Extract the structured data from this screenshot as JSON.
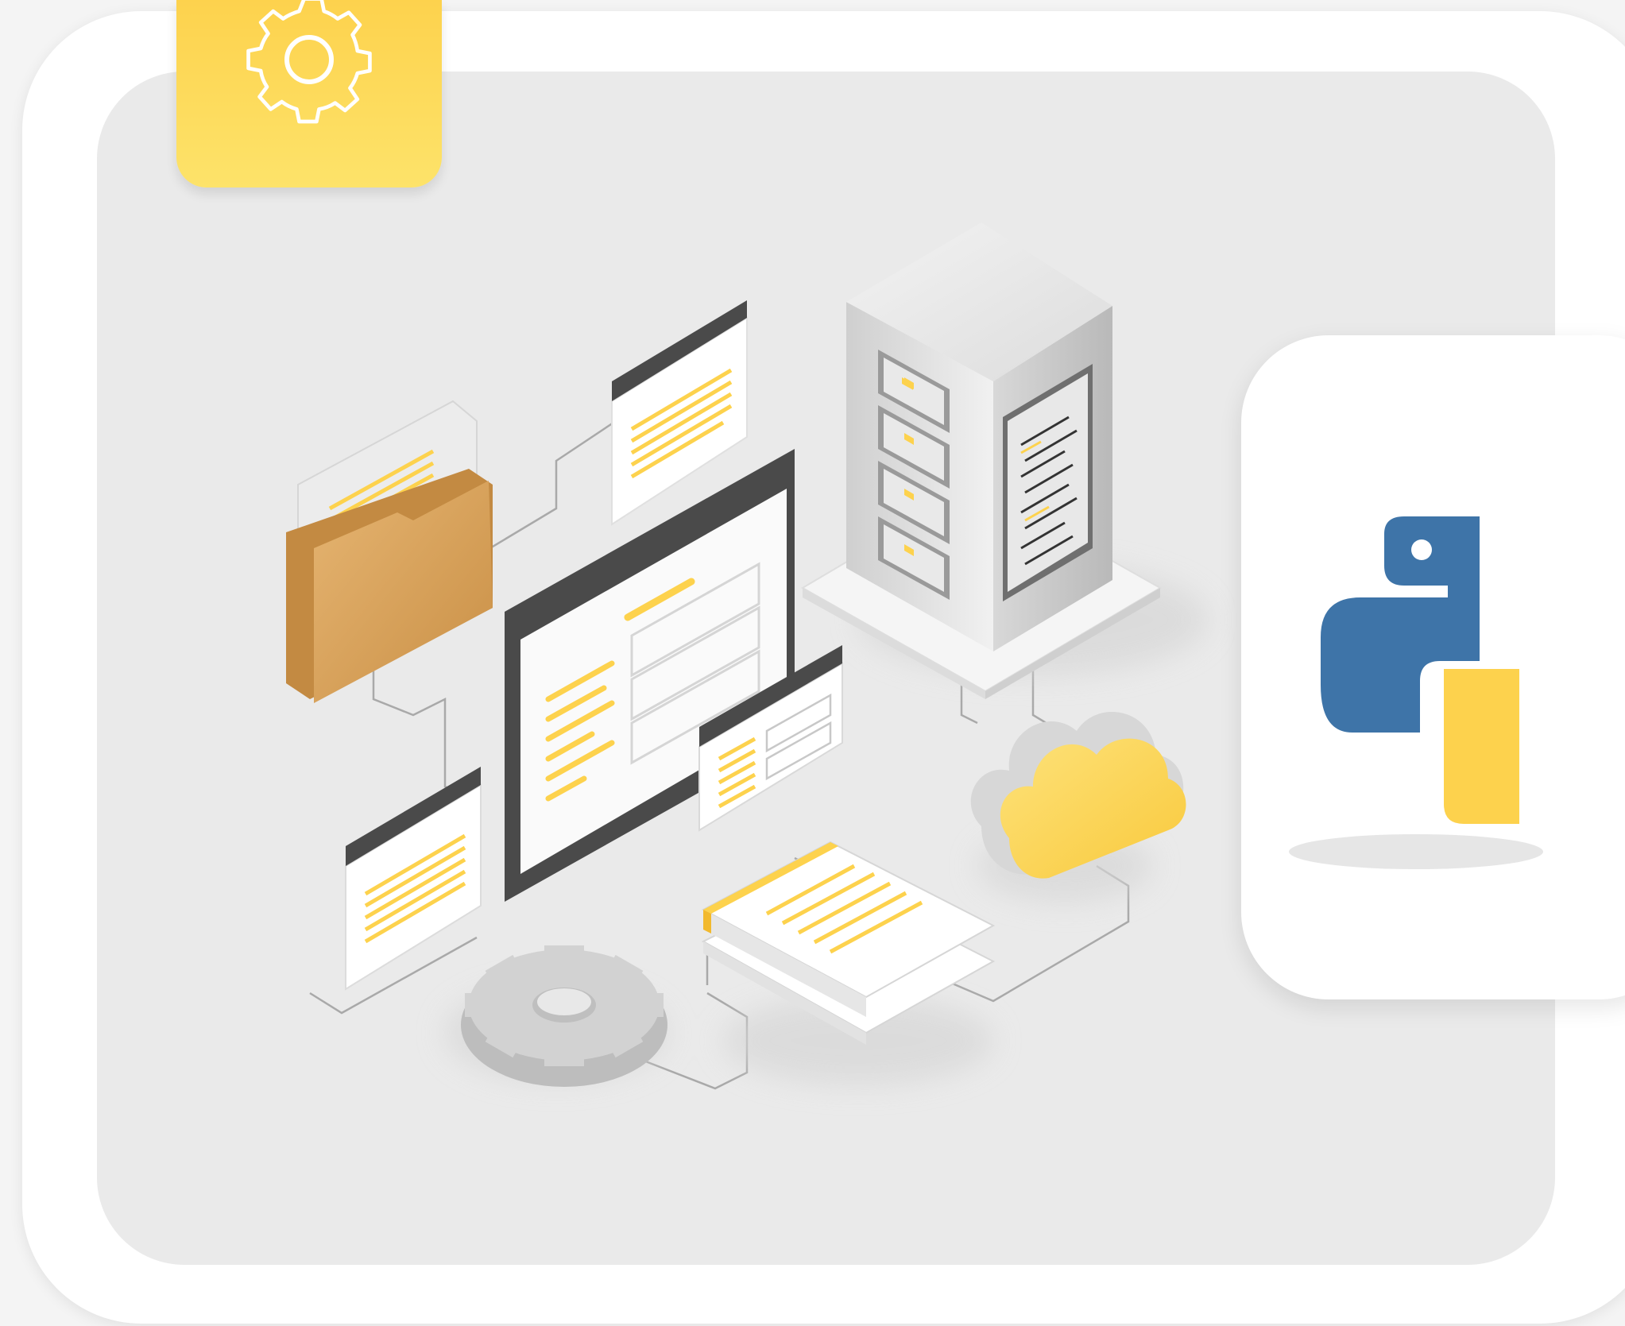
{
  "scene": {
    "background_color": "#f4f4f4",
    "panel_color": "#eaeaea",
    "accent_color": "#fdd24d",
    "folder_color": "#d9a05b",
    "python_blue": "#3e74a8",
    "python_yellow": "#fdd24d"
  },
  "icons": {
    "badge_icon": "gear-icon",
    "logo_icon": "python-logo-icon",
    "illustration_items": [
      "server-icon",
      "folder-icon",
      "document-icon",
      "browser-window-icon",
      "cloud-icon",
      "cog-icon",
      "book-stack-icon"
    ]
  }
}
